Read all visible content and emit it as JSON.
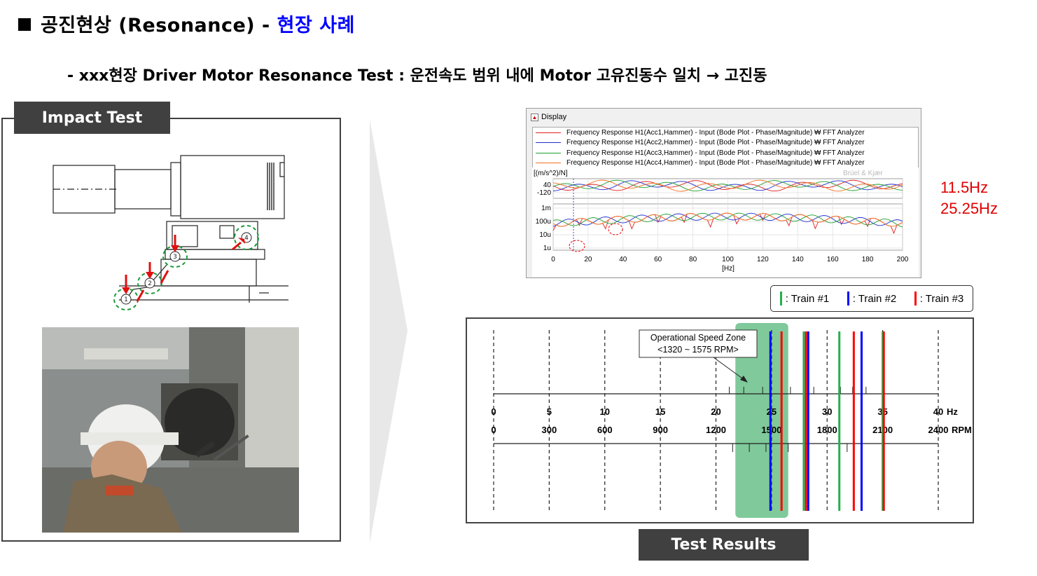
{
  "header": {
    "title_main": "공진현상 (Resonance) - ",
    "title_accent": "현장 사례",
    "subtitle": "- xxx현장 Driver Motor Resonance Test : 운전속도 범위 내에 Motor 고유진동수 일치 → 고진동"
  },
  "impact_test": {
    "label": "Impact Test"
  },
  "test_results": {
    "label": "Test Results"
  },
  "display_window": {
    "title": "Display",
    "legend": [
      {
        "text": "Frequency Response H1(Acc1,Hammer) - Input (Bode Plot - Phase/Magnitude) ₩ FFT Analyzer",
        "color": "#e02020"
      },
      {
        "text": "Frequency Response H1(Acc2,Hammer) - Input (Bode Plot - Phase/Magnitude) ₩ FFT Analyzer",
        "color": "#2030d0"
      },
      {
        "text": "Frequency Response H1(Acc3,Hammer) - Input (Bode Plot - Phase/Magnitude) ₩ FFT Analyzer",
        "color": "#20a030"
      },
      {
        "text": "Frequency Response H1(Acc4,Hammer) - Input (Bode Plot - Phase/Magnitude) ₩ FFT Analyzer",
        "color": "#f07020"
      }
    ],
    "unit_label": "[(m/s^2)/N]",
    "brand": "Brüel & Kjær",
    "phase_ticks": [
      "40",
      "-120"
    ],
    "mag_ticks": [
      "1m",
      "100u",
      "10u",
      "1u"
    ],
    "x_ticks": [
      "0",
      "20",
      "40",
      "60",
      "80",
      "100",
      "120",
      "140",
      "160",
      "180",
      "200"
    ],
    "x_unit": "[Hz]"
  },
  "frequencies": [
    "11.5Hz",
    "25.25Hz"
  ],
  "trains_legend": [
    {
      "label": ": Train #1",
      "color": "#22b14c"
    },
    {
      "label": ": Train #2",
      "color": "#0000ff"
    },
    {
      "label": ": Train #3",
      "color": "#ff0000"
    }
  ],
  "speed_chart": {
    "zone_label_1": "Operational Speed Zone",
    "zone_label_2": "<1320 ~ 1575 RPM>",
    "zone_rpm": [
      1320,
      1575
    ],
    "hz_ticks": [
      "0",
      "5",
      "10",
      "15",
      "20",
      "25",
      "30",
      "35",
      "40"
    ],
    "hz_unit": "Hz",
    "rpm_ticks": [
      "0",
      "300",
      "600",
      "900",
      "1200",
      "1500",
      "1800",
      "2100",
      "2400"
    ],
    "rpm_unit": "RPM",
    "hz_max": 40,
    "zone_color": "#7fc99a",
    "train_lines_hz": [
      {
        "hz": 24.9,
        "train": 2
      },
      {
        "hz": 25.9,
        "train": 3
      },
      {
        "hz": 27.9,
        "train": 1
      },
      {
        "hz": 28.1,
        "train": 3
      },
      {
        "hz": 28.3,
        "train": 2
      },
      {
        "hz": 31.1,
        "train": 1
      },
      {
        "hz": 32.4,
        "train": 3
      },
      {
        "hz": 33.1,
        "train": 2
      },
      {
        "hz": 35.0,
        "train": 1
      },
      {
        "hz": 35.1,
        "train": 3
      }
    ]
  }
}
